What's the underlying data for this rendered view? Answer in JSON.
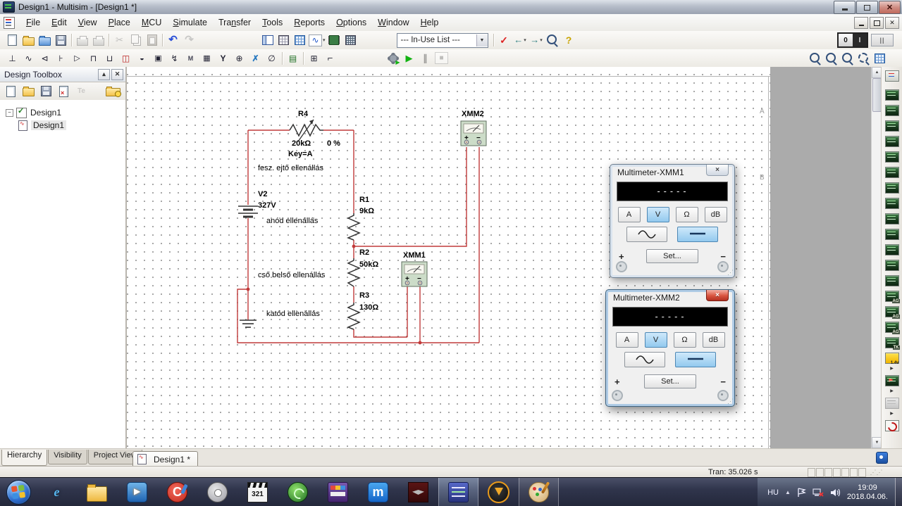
{
  "colors": {
    "accent_selected": "#92c9ee",
    "wire_red": "#c03a3a",
    "taskbar_bg": "#30354c",
    "canvas_dot": "#8f8f8f"
  },
  "window": {
    "title": "Design1 - Multisim - [Design1 *]"
  },
  "menubar": {
    "items": [
      {
        "label": "File",
        "u": 0
      },
      {
        "label": "Edit",
        "u": 0
      },
      {
        "label": "View",
        "u": 0
      },
      {
        "label": "Place",
        "u": 0
      },
      {
        "label": "MCU",
        "u": 0
      },
      {
        "label": "Simulate",
        "u": 0
      },
      {
        "label": "Transfer",
        "u": 3
      },
      {
        "label": "Tools",
        "u": 0
      },
      {
        "label": "Reports",
        "u": 0
      },
      {
        "label": "Options",
        "u": 0
      },
      {
        "label": "Window",
        "u": 0
      },
      {
        "label": "Help",
        "u": 0
      }
    ]
  },
  "toolbar_main": {
    "file_icons": [
      "new-file",
      "open-file",
      "open-samples",
      "save"
    ],
    "print_icons": [
      "print",
      "print-preview"
    ],
    "edit_icons": [
      "cut",
      "copy",
      "paste"
    ],
    "history_icons": [
      "undo",
      "redo"
    ],
    "view_icons": [
      "toggle-design-toolbox",
      "spreadsheet-view",
      "database-manager",
      "grapher",
      "create-component",
      "postprocessor"
    ],
    "in_use_list_label": "--- In-Use List ---",
    "check_icons": [
      "electrical-rules-check",
      "back-annotate",
      "forward-annotate",
      "find",
      "help"
    ],
    "rocker_labels": [
      "0",
      "I"
    ],
    "pause_label": "||"
  },
  "toolbar_components": {
    "component_icons": [
      "place-source",
      "place-basic",
      "place-diode",
      "place-transistor",
      "place-analog",
      "place-ttl",
      "place-cmos",
      "place-misc-digital",
      "place-mixed",
      "place-indicator",
      "place-power",
      "place-misc",
      "place-advanced-peripherals",
      "place-rf",
      "place-electromechanical",
      "place-ni",
      "place-connector"
    ],
    "mcu_icons": [
      "place-mcu"
    ],
    "wiring_icons": [
      "place-hierarchical-block",
      "place-bus"
    ],
    "sim_icons": [
      "interactive-simulation-settings",
      "run",
      "pause",
      "stop"
    ],
    "zoom_icons": [
      "zoom-in",
      "zoom-out",
      "zoom-page",
      "zoom-area",
      "zoom-fullscreen"
    ]
  },
  "design_toolbox": {
    "title": "Design Toolbox",
    "toolbar_icons": [
      "new-design",
      "open-design",
      "save-design",
      "close-design",
      "text-tool",
      "design-history"
    ],
    "tree": {
      "root_label": "Design1",
      "child_label": "Design1"
    },
    "bottom_tabs": [
      {
        "label": "Hierarchy",
        "active": true
      },
      {
        "label": "Visibility",
        "active": false
      },
      {
        "label": "Project View",
        "active": false
      }
    ]
  },
  "schematic": {
    "r4": {
      "ref": "R4",
      "value": "20kΩ",
      "percent": "0 %",
      "key": "Key=A",
      "note": "fesz. ejtő ellenállás"
    },
    "v2": {
      "ref": "V2",
      "value": "327V",
      "note": "anód ellenállás"
    },
    "r1": {
      "ref": "R1",
      "value": "9kΩ"
    },
    "r2": {
      "ref": "R2",
      "value": "50kΩ",
      "note": "cső belső ellenállás"
    },
    "r3": {
      "ref": "R3",
      "value": "130Ω",
      "note": "katód ellenállás"
    },
    "xmm1_label": "XMM1",
    "xmm2_label": "XMM2",
    "meter_plus": "+",
    "meter_minus": "−",
    "sheet_zones": [
      "A",
      "B"
    ]
  },
  "multimeters": [
    {
      "title": "Multimeter-XMM1",
      "display": "-----",
      "mode_buttons": [
        "A",
        "V",
        "Ω",
        "dB"
      ],
      "selected_mode": "V",
      "selected_wave": "dc",
      "set_label": "Set...",
      "plus": "+",
      "minus": "−",
      "active": false
    },
    {
      "title": "Multimeter-XMM2",
      "display": "-----",
      "mode_buttons": [
        "A",
        "V",
        "Ω",
        "dB"
      ],
      "selected_mode": "V",
      "selected_wave": "dc",
      "set_label": "Set...",
      "plus": "+",
      "minus": "−",
      "active": true
    }
  ],
  "instruments": [
    {
      "name": "multimeter",
      "style": "colorful"
    },
    {
      "name": "function-generator"
    },
    {
      "name": "wattmeter"
    },
    {
      "name": "oscilloscope"
    },
    {
      "name": "four-channel-oscilloscope"
    },
    {
      "name": "bode-plotter"
    },
    {
      "name": "frequency-counter"
    },
    {
      "name": "word-generator"
    },
    {
      "name": "logic-analyzer"
    },
    {
      "name": "logic-converter"
    },
    {
      "name": "iv-analyzer"
    },
    {
      "name": "distortion-analyzer"
    },
    {
      "name": "spectrum-analyzer"
    },
    {
      "name": "network-analyzer"
    },
    {
      "name": "agilent-function-generator",
      "tag": "AG"
    },
    {
      "name": "agilent-multimeter",
      "tag": "AG"
    },
    {
      "name": "agilent-oscilloscope",
      "tag": "AG"
    },
    {
      "name": "tektronix-oscilloscope",
      "tag": "TK"
    },
    {
      "name": "measurement-probe",
      "tag": "1.4v",
      "style": "probe",
      "caret": true
    },
    {
      "name": "ni-elvismx",
      "style": "elvis",
      "caret": true
    },
    {
      "name": "labview-instruments",
      "style": "gray",
      "caret": true
    },
    {
      "name": "current-clamp",
      "style": "clamp"
    }
  ],
  "document_tabs": [
    {
      "label": "Design1 *",
      "active": true
    }
  ],
  "statusbar": {
    "text": "Tran: 35.026 s"
  },
  "taskbar": {
    "apps": [
      {
        "name": "start-button"
      },
      {
        "name": "internet-explorer",
        "icon_text": "e"
      },
      {
        "name": "windows-explorer"
      },
      {
        "name": "windows-media-player"
      },
      {
        "name": "ccleaner",
        "icon_text": "C"
      },
      {
        "name": "recorder-app"
      },
      {
        "name": "media-player-classic",
        "icon_text": "321"
      },
      {
        "name": "green-orb-app"
      },
      {
        "name": "video-editor-app"
      },
      {
        "name": "maxthon-browser",
        "icon_text": "m"
      },
      {
        "name": "game-app"
      },
      {
        "name": "multisim",
        "open": true,
        "active": true
      },
      {
        "name": "daemon-tools"
      },
      {
        "name": "paint",
        "open": true
      }
    ],
    "tray": {
      "lang": "HU",
      "time": "19:09",
      "date": "2018.04.06."
    }
  }
}
